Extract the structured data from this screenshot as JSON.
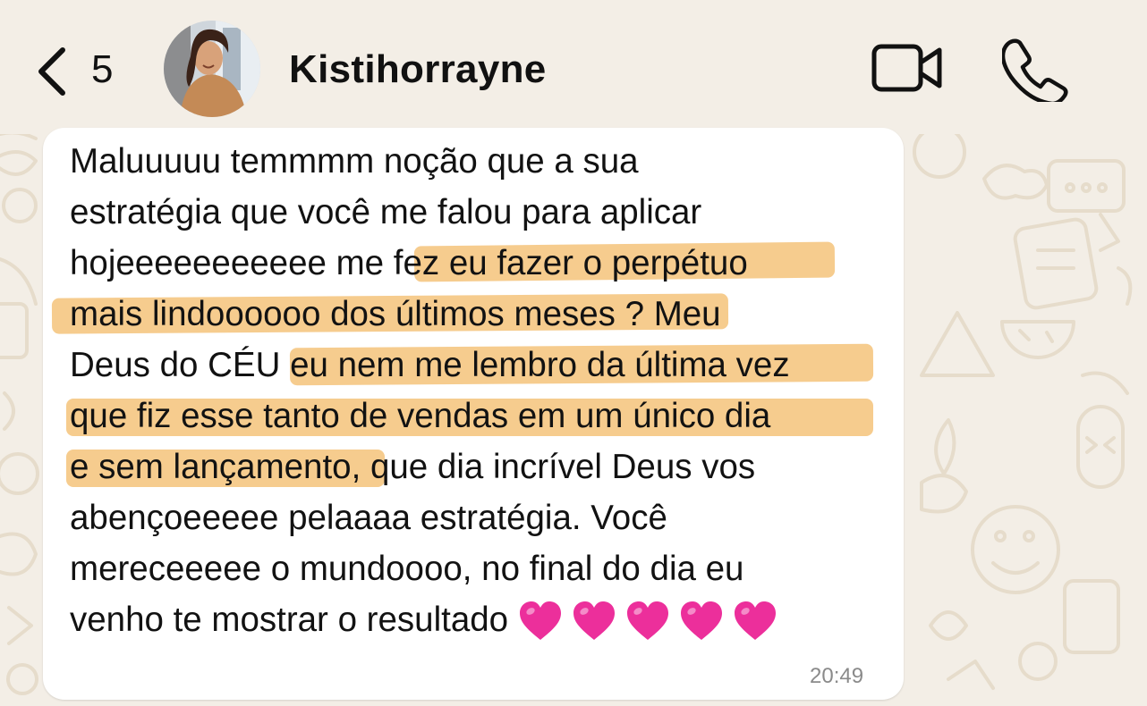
{
  "header": {
    "back_count": "5",
    "contact_name": "Kistihorrayne"
  },
  "message": {
    "lines": [
      "Maluuuuu temmmm noção que a sua",
      "estratégia que você me falou para aplicar",
      "hojeeeeeeeeeee me fez eu fazer o perpétuo",
      "mais lindoooooo dos últimos meses ? Meu",
      "Deus do CÉU eu nem me lembro da última vez",
      "que fiz esse tanto de vendas em um único dia",
      "e sem lançamento, que dia incrível Deus vos",
      "abençoeeeee pelaaaa estratégia. Você",
      "mereceeeee o mundoooo, no final do dia eu",
      "venho te mostrar o resultado"
    ],
    "emoji": [
      "💗",
      "💗",
      "💗",
      "💗",
      "💗"
    ],
    "time": "20:49"
  },
  "colors": {
    "background": "#f3eee6",
    "bubble": "#ffffff",
    "highlight": "#f5c37a",
    "heart": "#ec2f9b",
    "text": "#121212",
    "timestamp": "#8a8a8a"
  },
  "icons": {
    "back": "chevron-left-icon",
    "video": "video-camera-icon",
    "call": "phone-icon"
  }
}
